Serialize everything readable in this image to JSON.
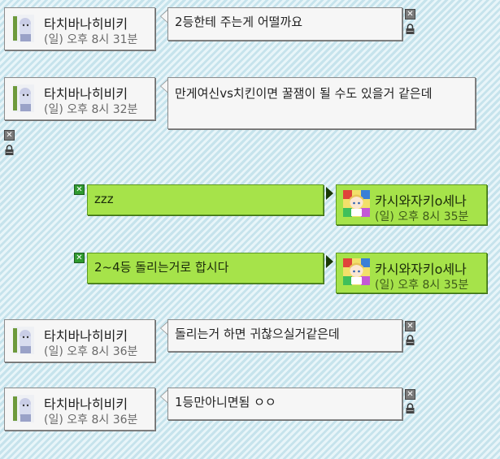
{
  "messages": [
    {
      "sender": "타치바나히비키",
      "time": "(일) 오후 8시 31분",
      "text": "2등한테 주는게 어떨까요",
      "side": "left"
    },
    {
      "sender": "타치바나히비키",
      "time": "(일) 오후 8시 32분",
      "text": "만게여신vs치킨이면 꿀잼이 될 수도 있을거 같은데",
      "side": "left"
    },
    {
      "sender": "카시와자키o세나",
      "time": "(일) 오후 8시 35분",
      "text": "zzz",
      "side": "right"
    },
    {
      "sender": "카시와자키o세나",
      "time": "(일) 오후 8시 35분",
      "text": "2~4등 돌리는거로 합시다",
      "side": "right"
    },
    {
      "sender": "타치바나히비키",
      "time": "(일) 오후 8시 36분",
      "text": "돌리는거 하면 귀찮으실거같은데",
      "side": "left"
    },
    {
      "sender": "타치바나히비키",
      "time": "(일) 오후 8시 36분",
      "text": "1등만아니면됨 ㅇㅇ",
      "side": "left"
    }
  ],
  "controls": {
    "close_glyph": "✕"
  },
  "icons": {
    "delete": "close-icon",
    "lock": "lock-icon"
  },
  "colors": {
    "left_bubble": "#f6f6f6",
    "right_bubble": "#a6e34a",
    "background": "#cfe9f1"
  }
}
